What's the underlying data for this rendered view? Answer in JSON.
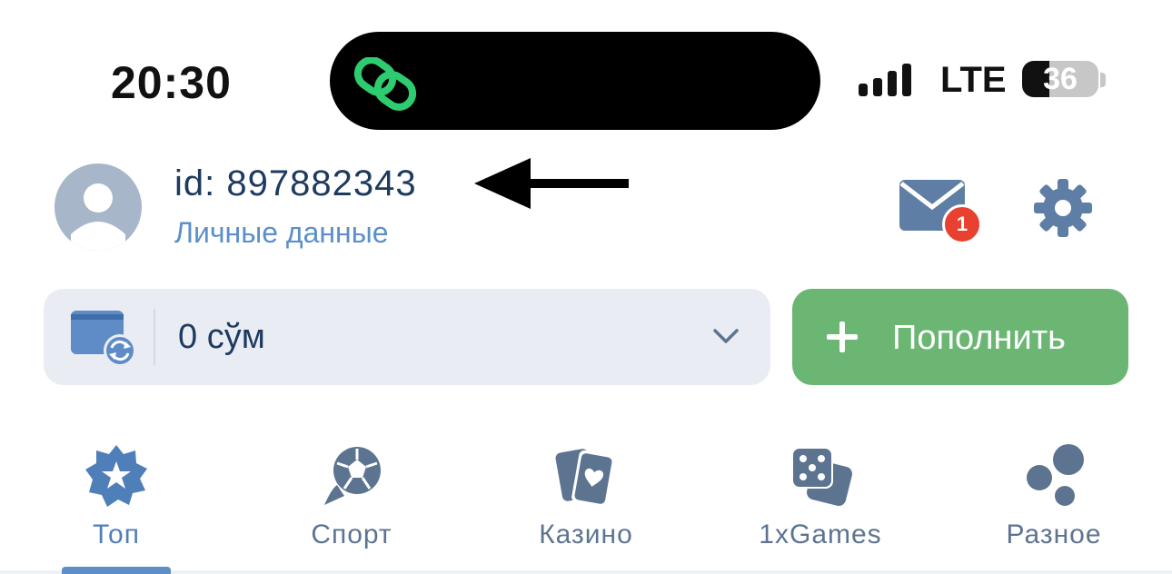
{
  "status_bar": {
    "time": "20:30",
    "network": "LTE",
    "battery_level": "36",
    "island_app_icon": "link-icon",
    "island_icon_color": "#2ecc71"
  },
  "profile": {
    "user_id": "id: 897882343",
    "personal_data_link": "Личные данные",
    "mail_badge_count": "1",
    "mail_icon": "mail-icon",
    "settings_icon": "gear-icon"
  },
  "balance": {
    "amount": "0 сўм",
    "wallet_icon": "wallet-refresh-icon"
  },
  "topup_button": {
    "label": "Пополнить",
    "icon": "plus-icon"
  },
  "nav": {
    "items": [
      {
        "label": "Топ",
        "icon": "star-badge-icon",
        "active": true
      },
      {
        "label": "Спорт",
        "icon": "soccer-ball-icon",
        "active": false
      },
      {
        "label": "Казино",
        "icon": "cards-icon",
        "active": false
      },
      {
        "label": "1xGames",
        "icon": "dice-icon",
        "active": false
      },
      {
        "label": "Разное",
        "icon": "bubbles-icon",
        "active": false
      }
    ]
  },
  "colors": {
    "accent_blue": "#5c8fc9",
    "dark_text": "#1d3a5f",
    "nav_icon": "#5d7491",
    "topup_green": "#6bb673",
    "badge_red": "#e8412f"
  }
}
